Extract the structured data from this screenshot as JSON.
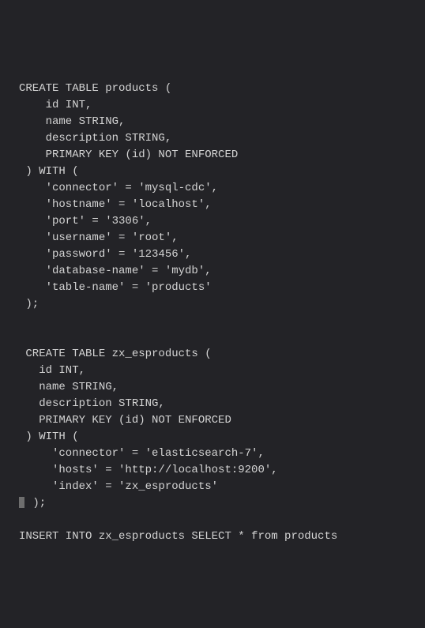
{
  "lines": [
    "CREATE TABLE products (",
    "    id INT,",
    "    name STRING,",
    "    description STRING,",
    "    PRIMARY KEY (id) NOT ENFORCED",
    " ) WITH (",
    "    'connector' = 'mysql-cdc',",
    "    'hostname' = 'localhost',",
    "    'port' = '3306',",
    "    'username' = 'root',",
    "    'password' = '123456',",
    "    'database-name' = 'mydb',",
    "    'table-name' = 'products'",
    " );",
    "",
    "",
    " CREATE TABLE zx_esproducts (",
    "   id INT,",
    "   name STRING,",
    "   description STRING,",
    "   PRIMARY KEY (id) NOT ENFORCED",
    " ) WITH (",
    "     'connector' = 'elasticsearch-7',",
    "     'hosts' = 'http://localhost:9200',",
    "     'index' = 'zx_esproducts'"
  ],
  "cursor_line": " );",
  "after_cursor": [
    "",
    "INSERT INTO zx_esproducts SELECT * from products"
  ]
}
